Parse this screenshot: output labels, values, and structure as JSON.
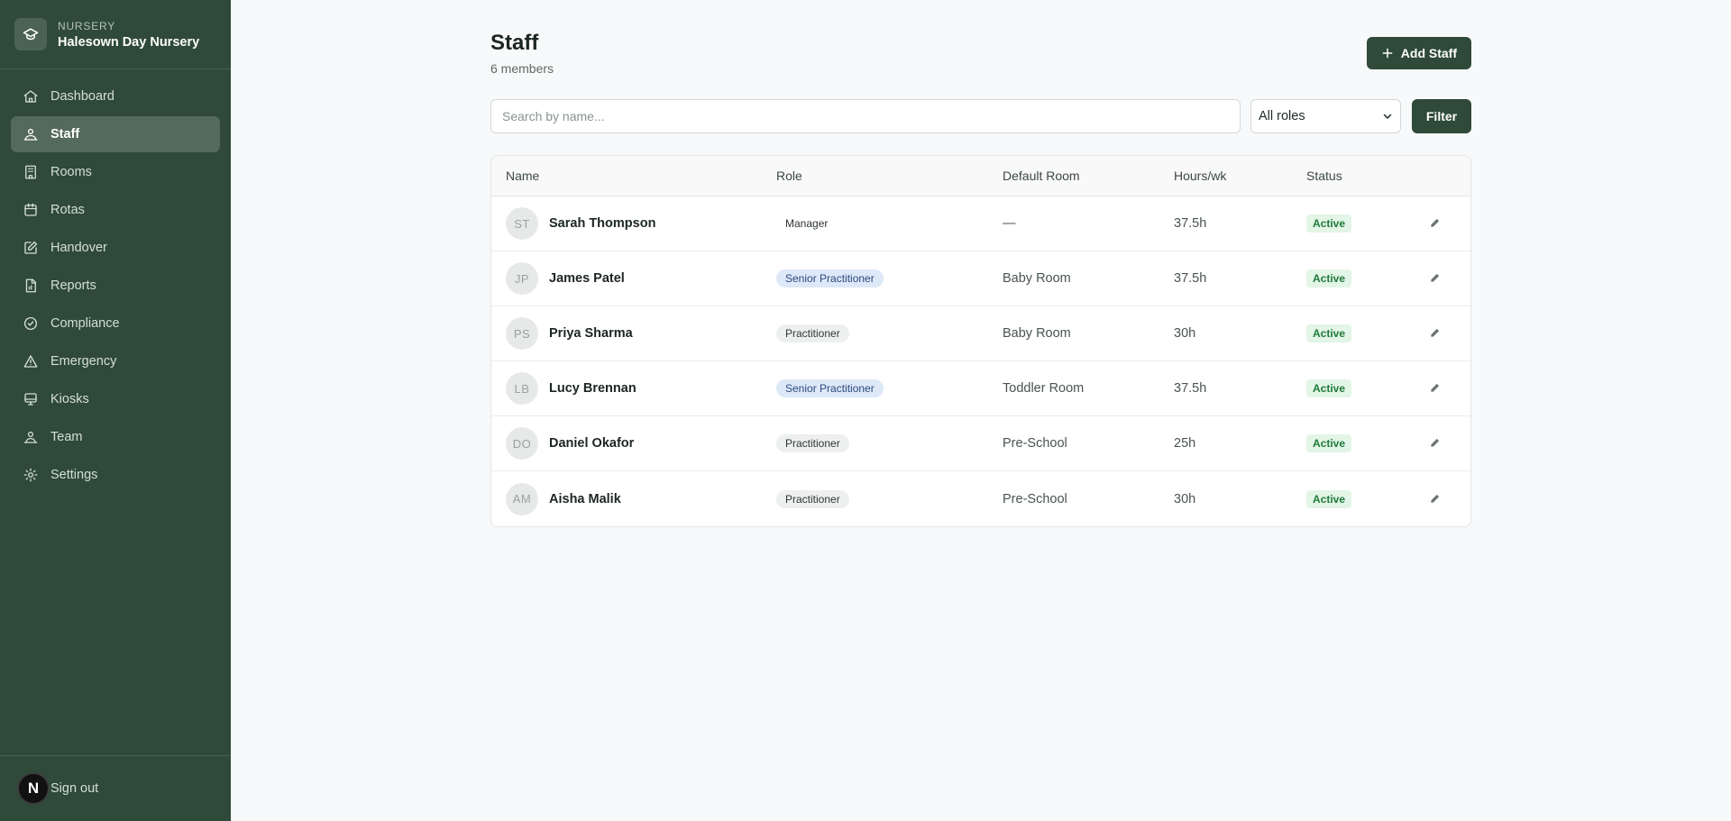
{
  "brand": {
    "label": "NURSERY",
    "name": "Halesown Day Nursery"
  },
  "nav": {
    "items": [
      {
        "label": "Dashboard",
        "icon": "home-icon",
        "active": false
      },
      {
        "label": "Staff",
        "icon": "staff-icon",
        "active": true
      },
      {
        "label": "Rooms",
        "icon": "building-icon",
        "active": false
      },
      {
        "label": "Rotas",
        "icon": "calendar-icon",
        "active": false
      },
      {
        "label": "Handover",
        "icon": "edit-icon",
        "active": false
      },
      {
        "label": "Reports",
        "icon": "report-icon",
        "active": false
      },
      {
        "label": "Compliance",
        "icon": "check-circle-icon",
        "active": false
      },
      {
        "label": "Emergency",
        "icon": "warning-icon",
        "active": false
      },
      {
        "label": "Kiosks",
        "icon": "kiosk-icon",
        "active": false
      },
      {
        "label": "Team",
        "icon": "team-icon",
        "active": false
      },
      {
        "label": "Settings",
        "icon": "gear-icon",
        "active": false
      }
    ]
  },
  "footer": {
    "avatar_letter": "N",
    "signout_label": "Sign out"
  },
  "header": {
    "title": "Staff",
    "subtitle": "6 members",
    "add_label": "Add Staff"
  },
  "filters": {
    "search_placeholder": "Search by name...",
    "role_value": "All roles",
    "filter_label": "Filter"
  },
  "table": {
    "columns": [
      "Name",
      "Role",
      "Default Room",
      "Hours/wk",
      "Status"
    ],
    "rows": [
      {
        "initials": "ST",
        "name": "Sarah Thompson",
        "role": "Manager",
        "role_type": "manager",
        "room": "—",
        "hours": "37.5h",
        "status": "Active"
      },
      {
        "initials": "JP",
        "name": "James Patel",
        "role": "Senior Practitioner",
        "role_type": "senior",
        "room": "Baby Room",
        "hours": "37.5h",
        "status": "Active"
      },
      {
        "initials": "PS",
        "name": "Priya Sharma",
        "role": "Practitioner",
        "role_type": "practitioner",
        "room": "Baby Room",
        "hours": "30h",
        "status": "Active"
      },
      {
        "initials": "LB",
        "name": "Lucy Brennan",
        "role": "Senior Practitioner",
        "role_type": "senior",
        "room": "Toddler Room",
        "hours": "37.5h",
        "status": "Active"
      },
      {
        "initials": "DO",
        "name": "Daniel Okafor",
        "role": "Practitioner",
        "role_type": "practitioner",
        "room": "Pre-School",
        "hours": "25h",
        "status": "Active"
      },
      {
        "initials": "AM",
        "name": "Aisha Malik",
        "role": "Practitioner",
        "role_type": "practitioner",
        "room": "Pre-School",
        "hours": "30h",
        "status": "Active"
      }
    ]
  },
  "colors": {
    "sidebar": "#2f4a38",
    "primary_button": "#2f4a38",
    "status_active_bg": "#e3f5e6",
    "status_active_text": "#1f7a3a",
    "senior_badge_bg": "#dde8f8"
  }
}
